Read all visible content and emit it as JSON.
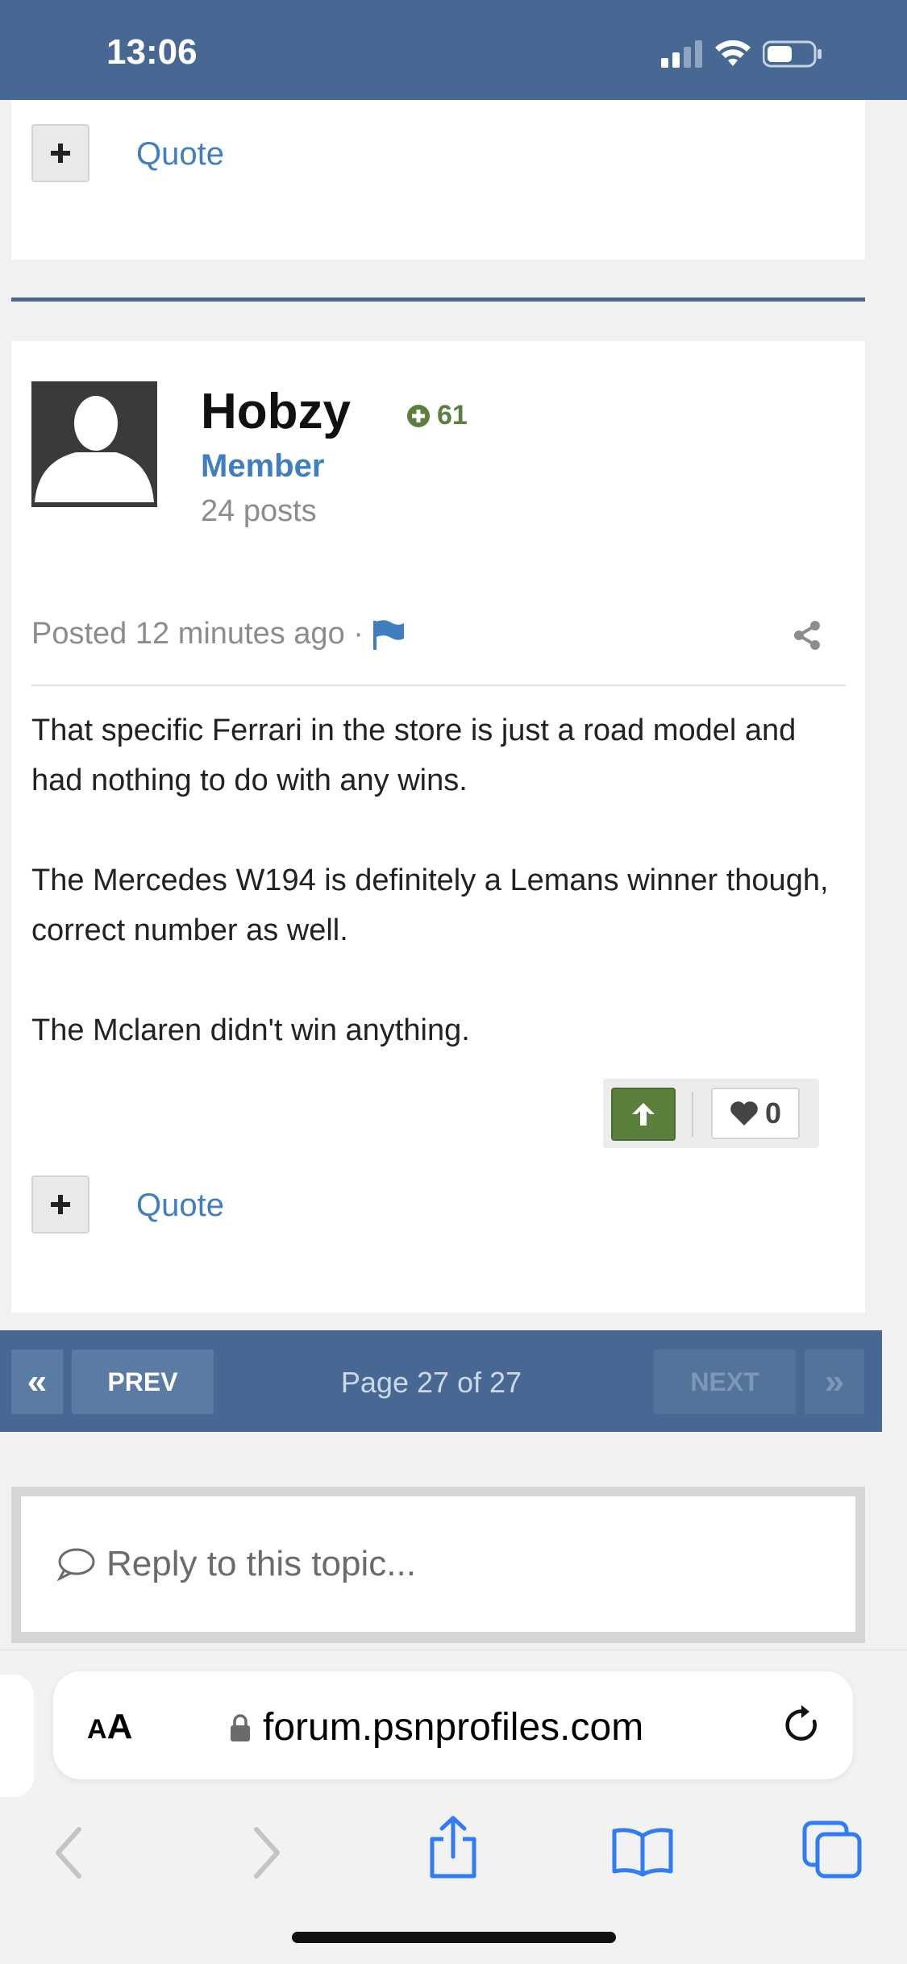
{
  "status_bar": {
    "time": "13:06"
  },
  "top_card": {
    "quote_label": "Quote"
  },
  "post": {
    "username": "Hobzy",
    "reputation": "61",
    "rank": "Member",
    "post_count": "24 posts",
    "posted": "Posted 12 minutes ago ·",
    "paragraphs": [
      "That specific Ferrari in the store is just a road model and had nothing to do with any wins.",
      "The Mercedes W194 is definitely a Lemans winner though, correct number as well.",
      "The Mclaren didn't win anything."
    ],
    "likes": "0",
    "quote_label": "Quote"
  },
  "pagination": {
    "first_icon": "«",
    "prev_label": "PREV",
    "page_label": "Page 27 of 27",
    "next_label": "NEXT",
    "last_icon": "»"
  },
  "reply": {
    "placeholder": "Reply to this topic..."
  },
  "browser": {
    "aa_label_small": "A",
    "aa_label": "A",
    "url": "forum.psnprofiles.com"
  },
  "colors": {
    "header": "#466892",
    "link": "#3f7fbf",
    "reputation": "#5b7f3c",
    "ios_blue": "#2f7cf6"
  }
}
